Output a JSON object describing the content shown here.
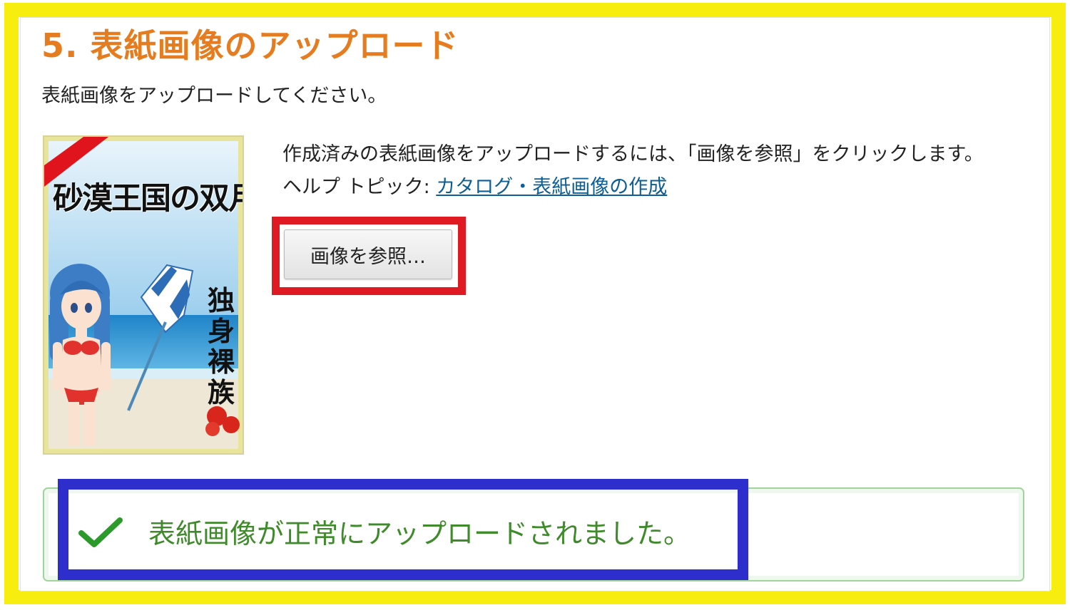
{
  "frame": {
    "highlight_color": "#f7ee10"
  },
  "section": {
    "title": "5. 表紙画像のアップロード",
    "title_color": "#e57c1f"
  },
  "instruction": "表紙画像をアップロードしてください。",
  "cover": {
    "title": "砂漠王国の双月姫",
    "author": "独身裸族",
    "icon": "book-cover-image"
  },
  "description": "作成済みの表紙画像をアップロードするには、「画像を参照」をクリックします。",
  "help": {
    "label": "ヘルプ トピック: ",
    "link_text": "カタログ・表紙画像の作成"
  },
  "browse_button": {
    "label": "画像を参照…",
    "highlight_color": "#e01a22"
  },
  "success": {
    "message": "表紙画像が正常にアップロードされました。",
    "icon": "checkmark-icon",
    "color": "#3f8a2a",
    "highlight_color": "#2e2ecc"
  }
}
